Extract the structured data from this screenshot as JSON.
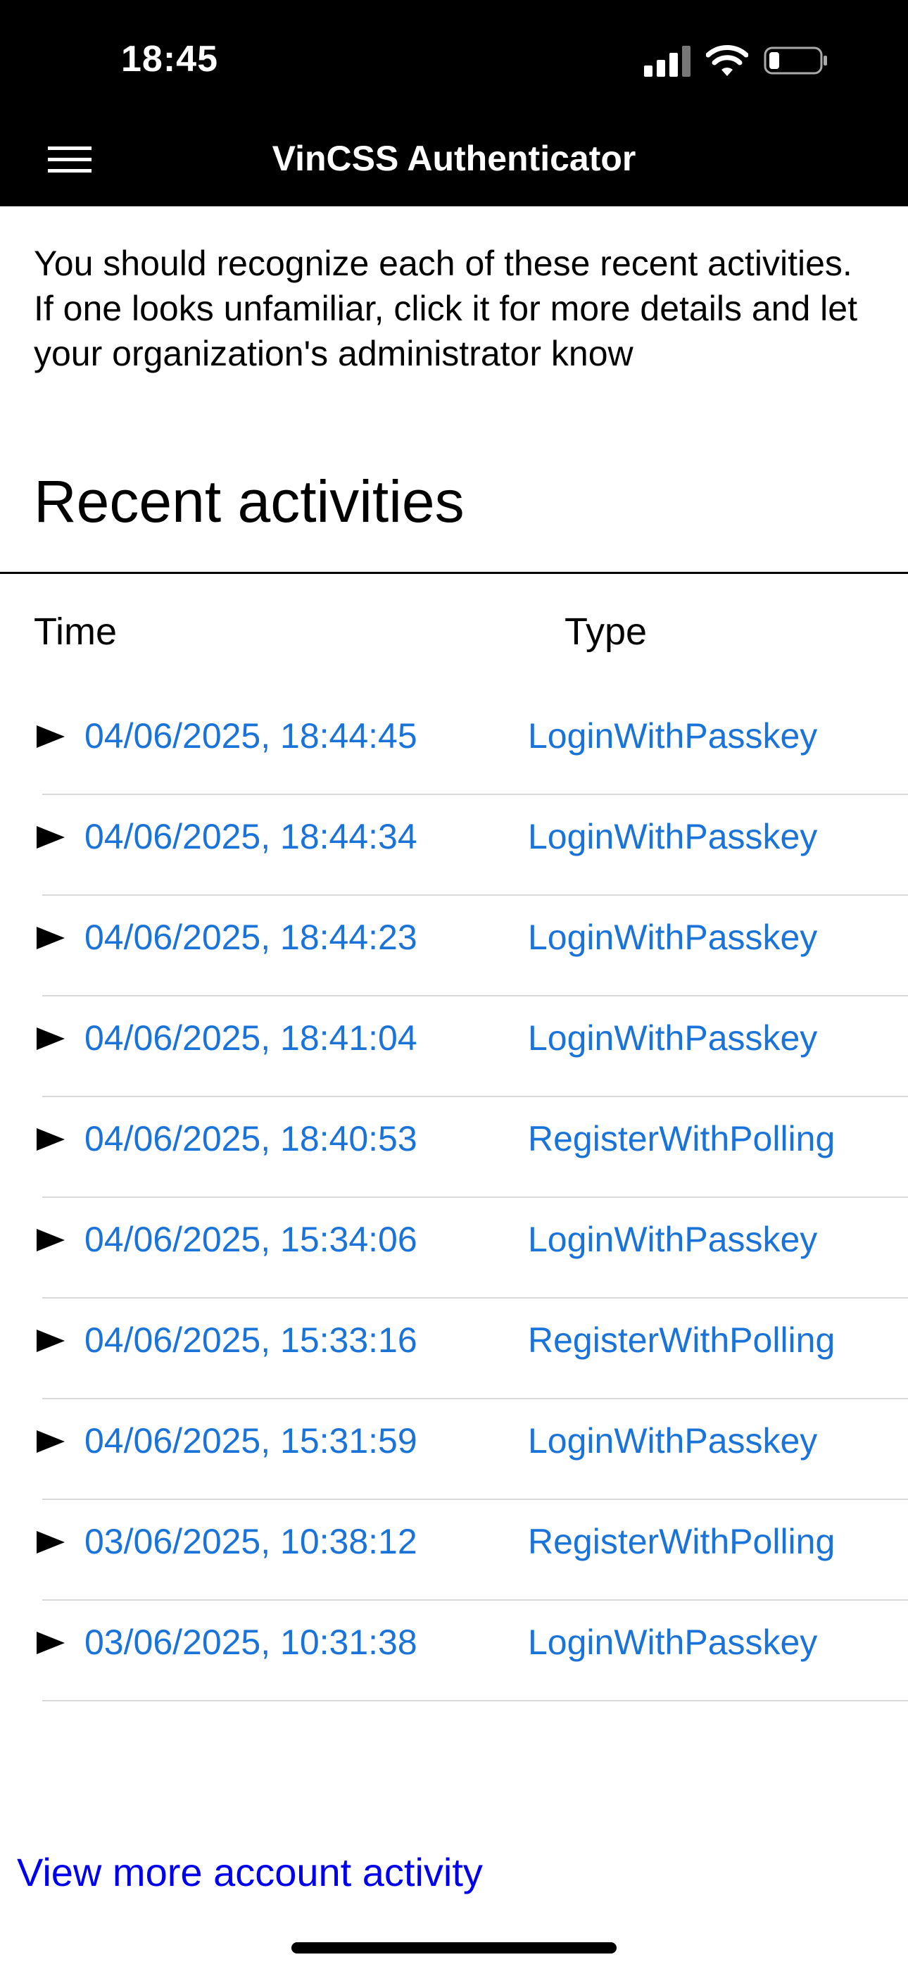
{
  "status_bar": {
    "time": "18:45"
  },
  "header": {
    "title": "VinCSS Authenticator",
    "menu_icon": "hamburger-menu-icon"
  },
  "intro_text": "You should recognize each of these recent activities. If one looks unfamiliar, click it for more details and let your organization's administrator know",
  "section_title": "Recent activities",
  "table": {
    "headers": {
      "time": "Time",
      "type": "Type"
    },
    "rows": [
      {
        "time": "04/06/2025, 18:44:45",
        "type": "LoginWithPasskey"
      },
      {
        "time": "04/06/2025, 18:44:34",
        "type": "LoginWithPasskey"
      },
      {
        "time": "04/06/2025, 18:44:23",
        "type": "LoginWithPasskey"
      },
      {
        "time": "04/06/2025, 18:41:04",
        "type": "LoginWithPasskey"
      },
      {
        "time": "04/06/2025, 18:40:53",
        "type": "RegisterWithPolling"
      },
      {
        "time": "04/06/2025, 15:34:06",
        "type": "LoginWithPasskey"
      },
      {
        "time": "04/06/2025, 15:33:16",
        "type": "RegisterWithPolling"
      },
      {
        "time": "04/06/2025, 15:31:59",
        "type": "LoginWithPasskey"
      },
      {
        "time": "03/06/2025, 10:38:12",
        "type": "RegisterWithPolling"
      },
      {
        "time": "03/06/2025, 10:31:38",
        "type": "LoginWithPasskey"
      }
    ]
  },
  "footer": {
    "more_link": "View more account activity"
  },
  "colors": {
    "link": "#1a73d9",
    "footer_link": "#0000ee",
    "header_bg": "#000000"
  }
}
